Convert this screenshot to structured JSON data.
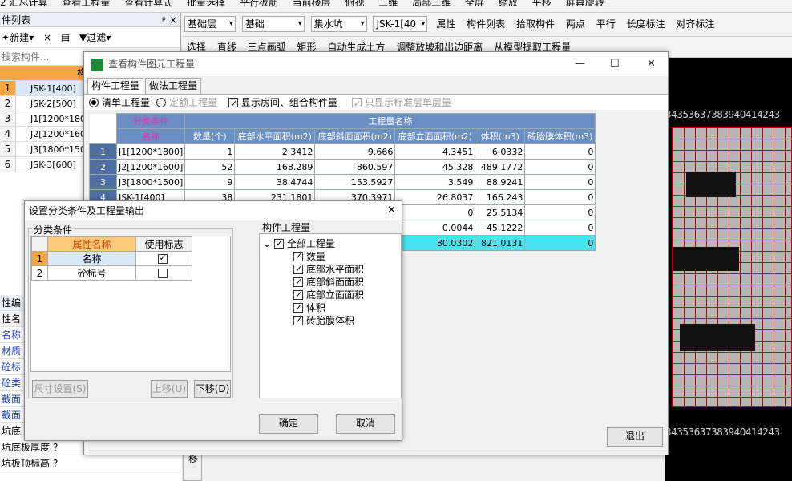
{
  "top_toolbar": {
    "items": [
      "2 汇总计算",
      "查看工程量",
      "查看计算式",
      "批量选择",
      "平行板筋",
      "当前楼层",
      "俯视",
      "三维",
      "局部三维",
      "全屏",
      "缩放",
      "平移",
      "屏幕旋转"
    ]
  },
  "left_panel": {
    "header": "件列表",
    "pin_glyph": "ᵖ ×",
    "toolbar": {
      "new": "新建",
      "delete": "×",
      "copy": "▤",
      "filter": "过滤"
    },
    "search_placeholder": "搜索构件...",
    "col_header": "构",
    "items": [
      {
        "n": "1",
        "name": "JSK-1[400]"
      },
      {
        "n": "2",
        "name": "JSK-2[500]"
      },
      {
        "n": "3",
        "name": "J1[1200*180"
      },
      {
        "n": "4",
        "name": "J2[1200*160"
      },
      {
        "n": "5",
        "name": "J3[1800*150"
      },
      {
        "n": "6",
        "name": "JSK-3[600]"
      }
    ]
  },
  "properties": {
    "header": "性编",
    "col": "性名",
    "rows": [
      "名称",
      "材质",
      "砼标",
      "砼类",
      "截面",
      "截面",
      "坑底",
      "坑底板厚度",
      "坑板顶标高"
    ],
    "val": "?"
  },
  "toolbar2": {
    "combos": [
      "基础层",
      "基础",
      "集水坑",
      "JSK-1[40"
    ],
    "buttons": [
      "属性",
      "构件列表",
      "拾取构件",
      "两点",
      "平行",
      "长度标注",
      "对齐标注"
    ]
  },
  "toolbar3": {
    "buttons": [
      "选择",
      "直线",
      "三点画弧",
      "矩形",
      "自动生成土方",
      "调整放坡和出边距离",
      "从模型提取工程量"
    ]
  },
  "canvas": {
    "ruler": "34353637383940414243"
  },
  "qty_window": {
    "title": "查看构件图元工程量",
    "min": "—",
    "max": "☐",
    "close": "✕",
    "tabs": [
      "构件工程量",
      "做法工程量"
    ],
    "options": {
      "r1": "清单工程量",
      "r2": "定额工程量",
      "c1": "显示房间、组合构件量",
      "c2": "只显示标准层单层量"
    },
    "h_category": "分类条件",
    "h_name": "名称",
    "h_qty": "工程量名称",
    "cols": [
      "数量(个)",
      "底部水平面积(m2)",
      "底部斜面面积(m2)",
      "底部立面面积(m2)",
      "体积(m3)",
      "砖胎膜体积(m3)"
    ],
    "rows": [
      {
        "n": "1",
        "name": "J1[1200*1800]",
        "v": [
          "1",
          "2.3412",
          "9.666",
          "4.3451",
          "6.0332",
          "0"
        ]
      },
      {
        "n": "2",
        "name": "J2[1200*1600]",
        "v": [
          "52",
          "168.289",
          "860.597",
          "45.328",
          "489.1772",
          "0"
        ]
      },
      {
        "n": "3",
        "name": "J3[1800*1500]",
        "v": [
          "9",
          "38.4744",
          "153.5927",
          "3.549",
          "88.9241",
          "0"
        ]
      },
      {
        "n": "4",
        "name": "JSK-1[400]",
        "v": [
          "38",
          "231.1801",
          "370.3971",
          "26.8037",
          "166.243",
          "0"
        ]
      },
      {
        "n": "",
        "name": "",
        "v": [
          "",
          "",
          "",
          "0",
          "25.5134",
          "0"
        ]
      },
      {
        "n": "",
        "name": "",
        "v": [
          "",
          "",
          "",
          "0.0044",
          "45.1222",
          "0"
        ]
      },
      {
        "n": "",
        "name": "",
        "v": [
          "",
          "",
          "",
          "80.0302",
          "821.0131",
          "0"
        ]
      }
    ],
    "exit": "退出"
  },
  "cat_dialog": {
    "title": "设置分类条件及工程量输出",
    "close": "✕",
    "group1": "分类条件",
    "col_attr": "属性名称",
    "col_use": "使用标志",
    "rows": [
      {
        "n": "1",
        "name": "名称",
        "use": true
      },
      {
        "n": "2",
        "name": "砼标号",
        "use": false
      }
    ],
    "btn_size": "尺寸设置(S)",
    "btn_up": "上移(U)",
    "btn_down": "下移(D)",
    "group2": "构件工程量",
    "tree_root": "全部工程量",
    "tree_items": [
      "数量",
      "底部水平面积",
      "底部斜面面积",
      "底部立面面积",
      "体积",
      "砖胎膜体积"
    ],
    "ok": "确定",
    "cancel": "取消"
  }
}
